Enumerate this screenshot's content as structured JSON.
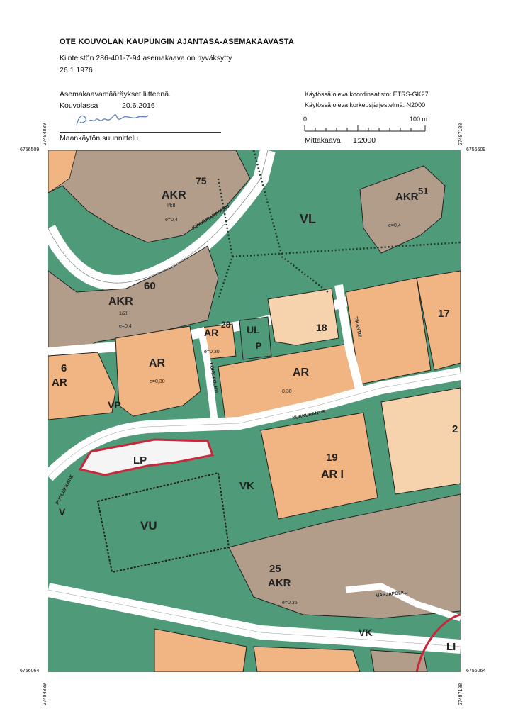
{
  "header": {
    "title": "OTE KOUVOLAN KAUPUNGIN AJANTASA-ASEMAKAAVASTA",
    "line1": "Kiinteistön 286-401-7-94 asemakaava on hyväksytty",
    "line2": "26.1.1976",
    "attachment": "Asemakaavamääräykset liitteenä.",
    "place": "Kouvolassa",
    "date": "20.6.2016",
    "department": "Maankäytön suunnittelu",
    "coord_system": "Käytössä oleva koordinaatisto: ETRS-GK27",
    "height_system": "Käytössä oleva korkeusjärjestelmä: N2000",
    "scale_label": "Mittakaava",
    "scale_value": "1:2000",
    "scale_zero": "0",
    "scale_end": "100 m"
  },
  "coordinates": {
    "top_left_x": "27484839",
    "top_right_x": "27487188",
    "bottom_left_x": "27484839",
    "bottom_right_x": "27487188",
    "top_y_left": "6756509",
    "top_y_right": "6756509",
    "bottom_y_left": "6756064",
    "bottom_y_right": "6756064"
  },
  "map": {
    "colors": {
      "green": "#4f9a78",
      "orange": "#f0b582",
      "light_orange": "#f6d2ad",
      "brown": "#b19d8a",
      "road": "#ffffff",
      "red": "#c8283c"
    },
    "zones": {
      "akr75_code": "AKR",
      "akr75_num": "75",
      "akr75_floors": "I/kII",
      "akr75_e": "e=0,4",
      "akr51_code": "AKR",
      "akr51_num": "51",
      "akr51_e": "e=0,4",
      "vl_code": "VL",
      "akr60_code": "AKR",
      "akr60_num": "60",
      "akr60_floors": "1/2II",
      "akr60_e": "e=0,4",
      "ar28_code": "AR",
      "ar28_num": "28",
      "ar28_e": "e=0,30",
      "ul_code": "UL",
      "p_label": "P",
      "b18_num": "18",
      "b17_num": "17",
      "ar_mid_code": "AR",
      "ar_mid_e": "e=0,30",
      "ar_center_code": "AR",
      "ar_center_e": "0,30",
      "b6_num": "6",
      "b6_code": "AR",
      "vp_code": "VP",
      "lp_code": "LP",
      "vk_code": "VK",
      "b19_num": "19",
      "b19_code": "AR I",
      "b2_num": "2",
      "vu_code": "VU",
      "v_code": "V",
      "akr25_num": "25",
      "akr25_code": "AKR",
      "akr25_e": "e=0,35",
      "vk2_code": "VK",
      "li_code": "LI"
    },
    "streets": {
      "kukkuranpolku": "KUKKURANPOLKU",
      "kukkurantie": "KUKKURANTIE",
      "marjapolku": "MARJAPOLKU",
      "tikantie": "TIKANTIE",
      "lokkipolku": "LOKKIPOLKU",
      "puolukkatie": "PUOLUKKATIE"
    }
  }
}
